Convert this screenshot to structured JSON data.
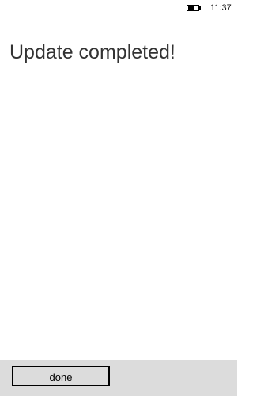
{
  "status_bar": {
    "battery_icon": "battery-icon",
    "battery_level": 0.6,
    "time": "11:37"
  },
  "main": {
    "title": "Update completed!"
  },
  "app_bar": {
    "done_label": "done"
  },
  "colors": {
    "background": "#ffffff",
    "app_bar": "#dcdcdc",
    "title_text": "#333333"
  }
}
